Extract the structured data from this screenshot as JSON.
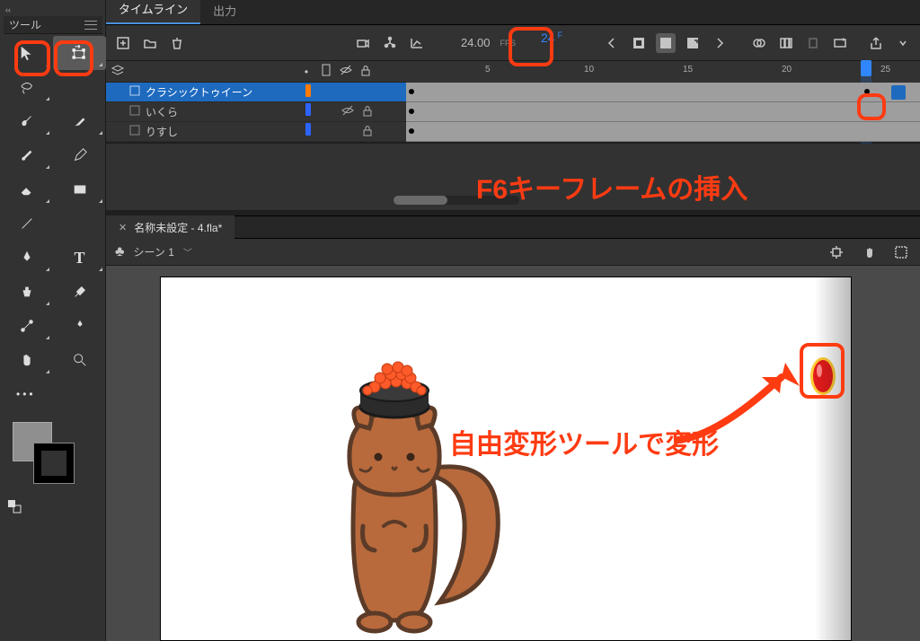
{
  "tool_panel": {
    "collapse": "‹‹",
    "title": "ツール"
  },
  "tabs": {
    "timeline": "タイムライン",
    "output": "出力"
  },
  "timeline": {
    "fps_value": "24.00",
    "fps_label": "FPS",
    "current_frame": "24",
    "current_frame_unit": "F",
    "ruler": {
      "t5": "5",
      "t10": "10",
      "t15": "15",
      "t20": "20",
      "t25": "25"
    },
    "layers": [
      {
        "name": "クラシックトゥイーン",
        "color": "orange",
        "visible": true,
        "locked": false,
        "selected": true
      },
      {
        "name": "いくら",
        "color": "blue",
        "visible": false,
        "locked": true,
        "selected": false
      },
      {
        "name": "りすし",
        "color": "blue",
        "visible": true,
        "locked": true,
        "selected": false
      }
    ]
  },
  "document": {
    "filename": "名称未設定 - 4.fla*",
    "scene": "シーン 1"
  },
  "annotations": {
    "keyframe": "F6キーフレームの挿入",
    "freetransform": "自由変形ツールで変形"
  }
}
